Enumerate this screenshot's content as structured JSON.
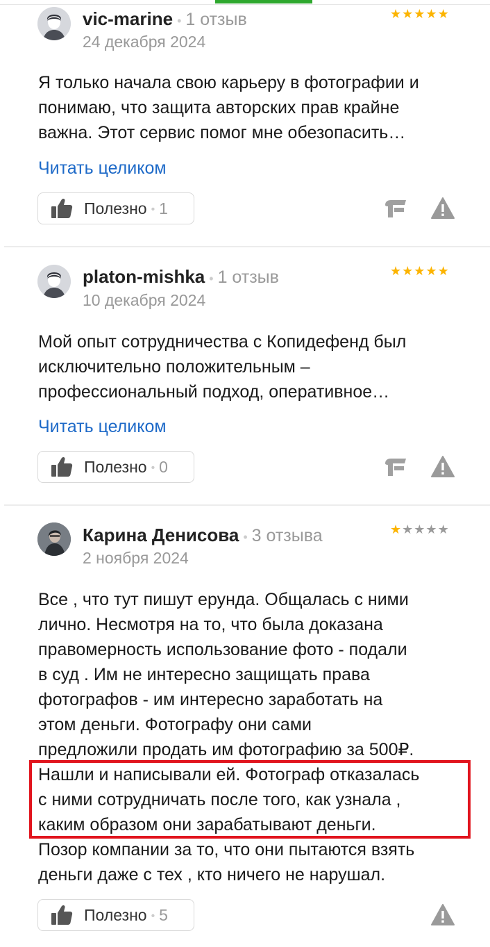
{
  "reviews": [
    {
      "author": "vic-marine",
      "reviews_count": "1 отзыв",
      "date": "24 декабря 2024",
      "rating": 5,
      "text_lines": [
        "Я только начала свою карьеру в фотографии и",
        "понимаю, что защита авторских прав крайне",
        "важна. Этот сервис помог мне обезопасить…"
      ],
      "read_more": "Читать целиком",
      "useful_label": "Полезно",
      "useful_count": "1"
    },
    {
      "author": "platon-mishka",
      "reviews_count": "1 отзыв",
      "date": "10 декабря 2024",
      "rating": 5,
      "text_lines": [
        "Мой опыт сотрудничества с Копидефенд был",
        "исключительно положительным –",
        "профессиональный подход, оперативное…"
      ],
      "read_more": "Читать целиком",
      "useful_label": "Полезно",
      "useful_count": "0"
    },
    {
      "author": "Карина Денисова",
      "reviews_count": "3 отзыва",
      "date": "2 ноября 2024",
      "rating": 1,
      "text_lines": [
        "Все , что тут пишут ерунда. Общалась с ними",
        "лично. Несмотря на то, что была доказана",
        "правомерность использование фото - подали",
        "в суд . Им не интересно защищать права",
        "фотографов - им интересно заработать на",
        "этом деньги. Фотографу они сами",
        "предложили продать им фотографию за 500₽.",
        "Нашли и написывали ей. Фотограф отказалась",
        "с ними сотрудничать после того, как узнала ,",
        "каким образом они зарабатывают деньги.",
        "Позор компании за то, что они пытаются взять",
        "деньги даже с тех , кто ничего не нарушал."
      ],
      "useful_label": "Полезно",
      "useful_count": "5"
    }
  ],
  "colors": {
    "star_active": "#fcb400",
    "star_inactive": "#9a9a9a",
    "link": "#1e6ac8",
    "highlight_border": "#e1141d"
  },
  "icons": [
    "avatar-placeholder-icon",
    "thumbs-up-icon",
    "official-response-icon",
    "warning-report-icon"
  ]
}
